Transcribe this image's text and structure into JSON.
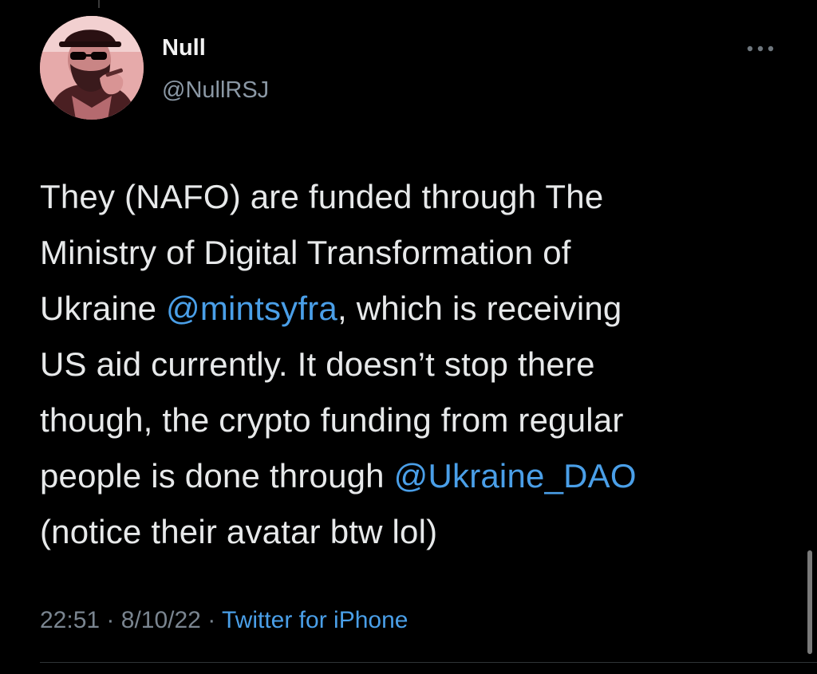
{
  "tweet": {
    "author": {
      "display_name": "Null",
      "handle": "@NullRSJ",
      "avatar_icon": "user-avatar-sunglasses"
    },
    "more_icon": "more-horizontal-icon",
    "text_lines": [
      [
        {
          "t": "They (NAFO) are funded through The",
          "m": false
        }
      ],
      [
        {
          "t": "Ministry of Digital Transformation of",
          "m": false
        }
      ],
      [
        {
          "t": "Ukraine ",
          "m": false
        },
        {
          "t": "@mintsyfra",
          "m": true
        },
        {
          "t": ", which is receiving",
          "m": false
        }
      ],
      [
        {
          "t": "US aid currently. It doesn’t stop there",
          "m": false
        }
      ],
      [
        {
          "t": "though, the crypto funding from regular",
          "m": false
        }
      ],
      [
        {
          "t": "people is done through ",
          "m": false
        },
        {
          "t": "@Ukraine_DAO",
          "m": true
        }
      ],
      [
        {
          "t": "(notice their avatar btw lol)",
          "m": false
        }
      ]
    ],
    "time": "22:51",
    "separator": "·",
    "date": "8/10/22",
    "source": "Twitter for iPhone"
  },
  "colors": {
    "background": "#000000",
    "text": "#e7e9ea",
    "secondary": "#8b98a5",
    "link": "#4a9fe8"
  }
}
